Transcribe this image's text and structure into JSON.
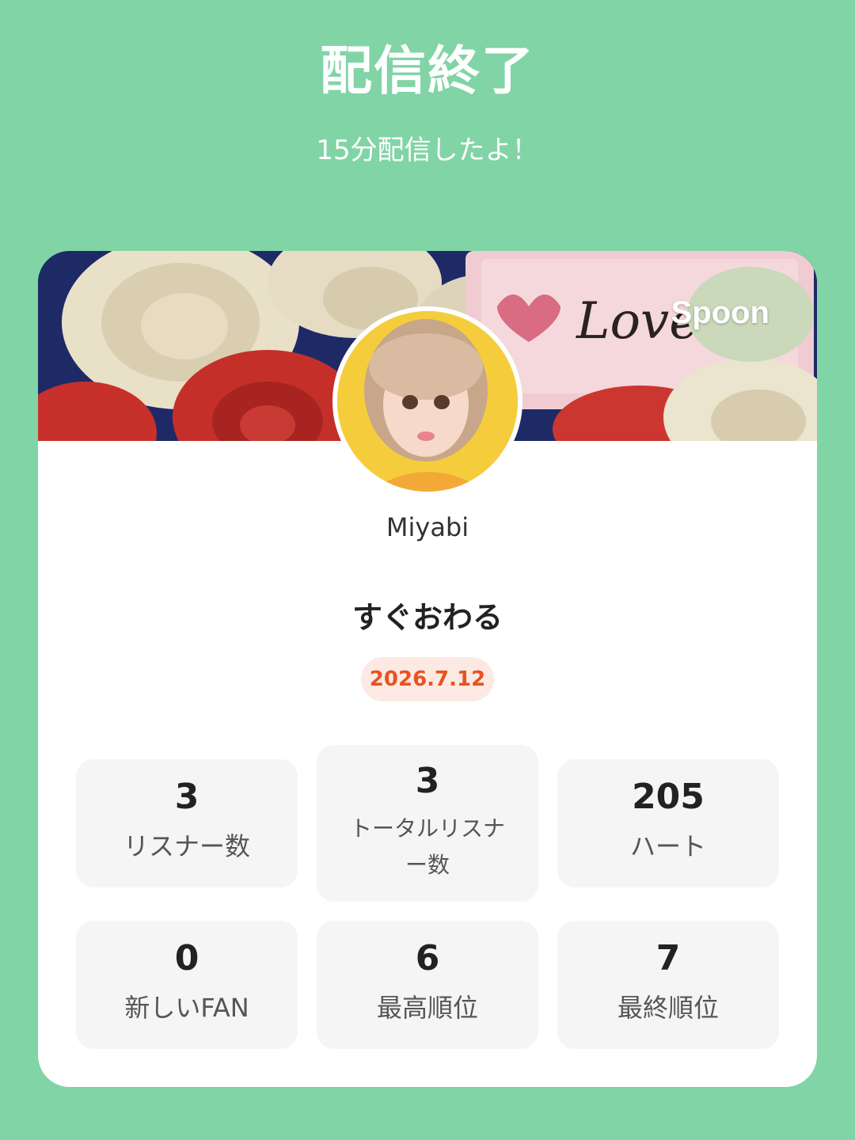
{
  "header": {
    "title": "配信終了",
    "subtitle": "15分配信したよ！"
  },
  "card": {
    "brand": "Spoon",
    "username": "Miyabi",
    "stream_title": "すぐおわる",
    "date": "2026.7.12",
    "banner_text": "Love you"
  },
  "stats": [
    {
      "value": "3",
      "label": "リスナー数"
    },
    {
      "value": "3",
      "label": "トータルリスナー数"
    },
    {
      "value": "205",
      "label": "ハート"
    },
    {
      "value": "0",
      "label": "新しいFAN"
    },
    {
      "value": "6",
      "label": "最高順位"
    },
    {
      "value": "7",
      "label": "最終順位"
    }
  ],
  "colors": {
    "background": "#81d4a6",
    "card": "#ffffff",
    "date_text": "#e8531f",
    "date_bg": "#fde9e3",
    "stat_bg": "#f5f5f5"
  }
}
